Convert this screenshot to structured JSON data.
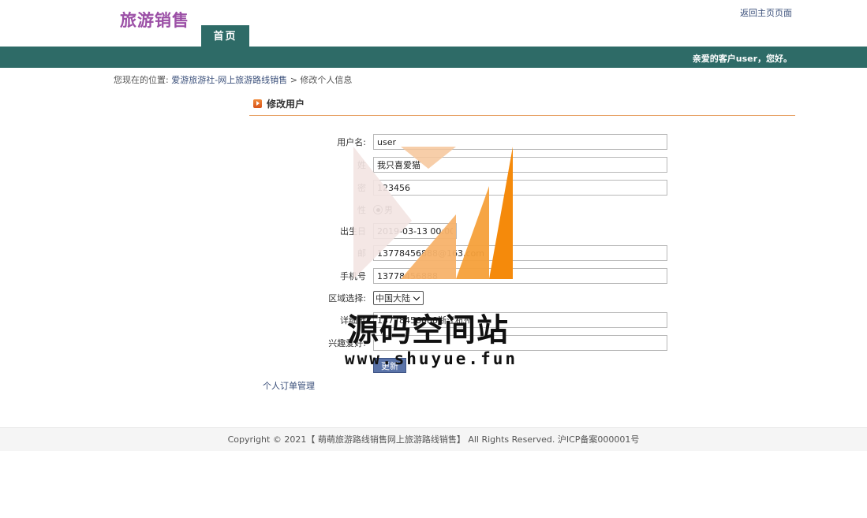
{
  "header": {
    "brand": "旅游销售",
    "home_link": "返回主页页面",
    "nav_tab": "首页"
  },
  "navbar": {
    "greeting": "亲爱的客户user，您好。"
  },
  "breadcrumb": {
    "prefix": "您现在的位置:",
    "site_link": "爱游旅游社-网上旅游路线销售",
    "separator": ">",
    "current": "修改个人信息"
  },
  "section": {
    "title": "修改用户"
  },
  "form": {
    "fields": [
      {
        "label": "用户名:",
        "value": "user"
      },
      {
        "label": "姓",
        "value": "我只喜爱猫"
      },
      {
        "label": "密",
        "value": "123456"
      },
      {
        "label": "性",
        "value": "男"
      },
      {
        "label": "出生日",
        "value": "2019-03-13 00:00:00"
      },
      {
        "label": "邮",
        "value": "13778456888@163.com"
      },
      {
        "label": "手机号",
        "value": "13778456888"
      },
      {
        "label": "区域选择:",
        "value": "中国大陆"
      },
      {
        "label": "详细地",
        "value": "13778456888浙江杭州"
      },
      {
        "label": "兴趣爱好:",
        "value": ""
      }
    ],
    "submit_label": "更新"
  },
  "links": {
    "orders": "个人订单管理"
  },
  "footer": {
    "text": "Copyright © 2021【 萌萌旅游路线销售网上旅游路线销售】 All Rights Reserved. 沪ICP备案000001号"
  },
  "watermark": {
    "text": "源码空间站",
    "url": "www.shuyue.fun"
  },
  "colors": {
    "brand": "#9b4fa6",
    "navbar": "#2e6b67",
    "accent_rule": "#e8a46a",
    "button": "#5a73a8"
  }
}
